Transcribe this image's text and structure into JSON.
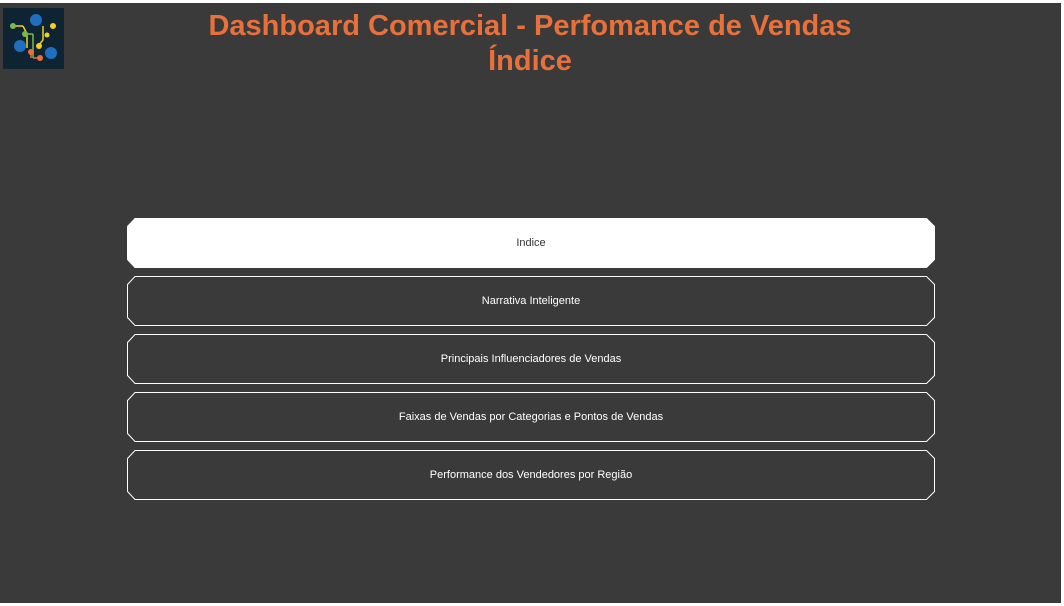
{
  "header": {
    "logo_icon": "network-nodes-icon",
    "title": "Dashboard Comercial - Perfomance de Vendas",
    "subtitle": "Índice"
  },
  "nav": {
    "items": [
      {
        "label": "Indice",
        "active": true
      },
      {
        "label": "Narrativa Inteligente",
        "active": false
      },
      {
        "label": "Principais Influenciadores de Vendas",
        "active": false
      },
      {
        "label": "Faixas de Vendas por Categorias e Pontos de Vendas",
        "active": false
      },
      {
        "label": "Performance dos Vendedores por Região",
        "active": false
      }
    ]
  },
  "colors": {
    "background": "#3a3a3a",
    "accent": "#e8703a",
    "button_active_fill": "#ffffff",
    "button_border": "#ffffff"
  }
}
